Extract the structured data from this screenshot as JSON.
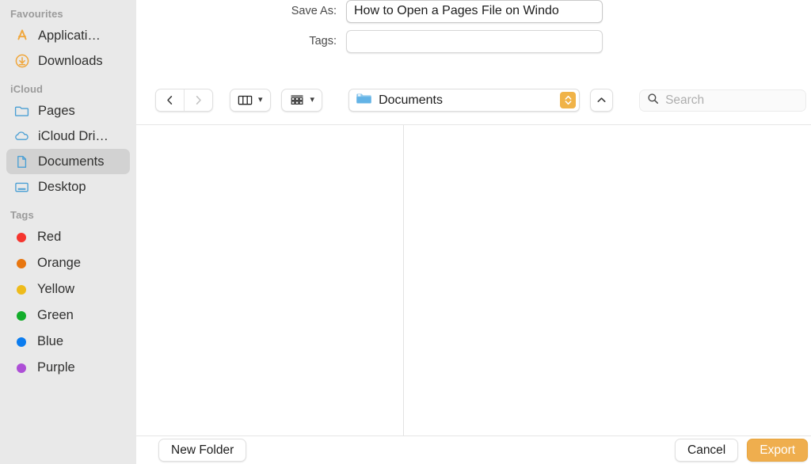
{
  "sidebar": {
    "sections": [
      {
        "header": "Favourites",
        "items": [
          {
            "label": "Applicati…",
            "icon": "applications-icon",
            "selected": false
          },
          {
            "label": "Downloads",
            "icon": "downloads-icon",
            "selected": false
          }
        ]
      },
      {
        "header": "iCloud",
        "items": [
          {
            "label": "Pages",
            "icon": "folder-icon",
            "selected": false
          },
          {
            "label": "iCloud Dri…",
            "icon": "cloud-icon",
            "selected": false
          },
          {
            "label": "Documents",
            "icon": "document-icon",
            "selected": true
          },
          {
            "label": "Desktop",
            "icon": "desktop-icon",
            "selected": false
          }
        ]
      },
      {
        "header": "Tags",
        "items": [
          {
            "label": "Red",
            "icon": "tag-dot-icon",
            "color": "#f5352e"
          },
          {
            "label": "Orange",
            "icon": "tag-dot-icon",
            "color": "#e8760f"
          },
          {
            "label": "Yellow",
            "icon": "tag-dot-icon",
            "color": "#eebb1b"
          },
          {
            "label": "Green",
            "icon": "tag-dot-icon",
            "color": "#13ad2b"
          },
          {
            "label": "Blue",
            "icon": "tag-dot-icon",
            "color": "#0b7cef"
          },
          {
            "label": "Purple",
            "icon": "tag-dot-icon",
            "color": "#ad4fd6"
          }
        ]
      }
    ]
  },
  "fields": {
    "save_as_label": "Save As:",
    "save_as_value": "How to Open a Pages File on Windo",
    "tags_label": "Tags:",
    "tags_value": "",
    "tags_placeholder": ""
  },
  "toolbar": {
    "back_icon": "chevron-left-icon",
    "forward_icon": "chevron-right-icon",
    "column_view_icon": "column-view-icon",
    "gallery_view_icon": "gallery-view-icon",
    "view_dropdown_icon": "chevron-down-icon",
    "path_folder_icon": "folder-icon",
    "path_label": "Documents",
    "path_stepper_icon": "up-down-stepper-icon",
    "up_icon": "chevron-up-icon",
    "search_icon": "search-icon",
    "search_placeholder": "Search",
    "search_value": ""
  },
  "bottom": {
    "new_folder_label": "New Folder",
    "cancel_label": "Cancel",
    "export_label": "Export"
  },
  "colors": {
    "accent": "#efae4e",
    "sidebar_bg": "#e9e9e9",
    "selected_row": "#d2d2d2",
    "icon_blue": "#4a9fd4",
    "icon_orange": "#f0a63a"
  }
}
